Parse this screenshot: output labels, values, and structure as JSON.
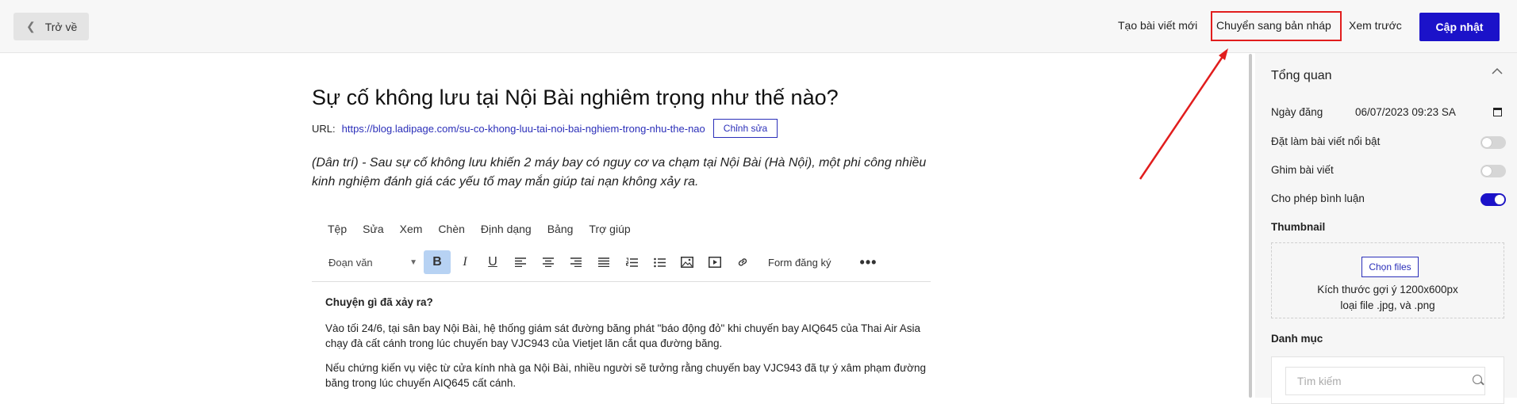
{
  "topbar": {
    "back_label": "Trở về",
    "new_post": "Tạo bài viết mới",
    "to_draft": "Chuyển sang bản nháp",
    "preview": "Xem trước",
    "update": "Cập nhật"
  },
  "annotation": {
    "highlight_color": "#e11d1d"
  },
  "post": {
    "title": "Sự cố không lưu tại Nội Bài nghiêm trọng như thế nào?",
    "url_label": "URL:",
    "url": "https://blog.ladipage.com/su-co-khong-luu-tai-noi-bai-nghiem-trong-nhu-the-nao",
    "edit_label": "Chỉnh sửa",
    "excerpt": "(Dân trí) - Sau sự cố không lưu khiến 2 máy bay có nguy cơ va chạm tại Nội Bài (Hà Nội), một phi công nhiều kinh nghiệm đánh giá các yếu tố may mắn giúp tai nạn không xảy ra."
  },
  "editor": {
    "menu": [
      "Tệp",
      "Sửa",
      "Xem",
      "Chèn",
      "Định dạng",
      "Bảng",
      "Trợ giúp"
    ],
    "paragraph_select": "Đoạn văn",
    "form_label": "Form đăng ký",
    "heading": "Chuyện gì đã xảy ra?",
    "paragraphs": [
      "Vào tối 24/6, tại sân bay Nội Bài, hệ thống giám sát đường băng phát \"báo động đỏ\" khi chuyến bay AIQ645 của Thai Air Asia chạy đà cất cánh trong lúc chuyến bay VJC943 của Vietjet lăn cắt qua đường băng.",
      "Nếu chứng kiến vụ việc từ cửa kính nhà ga Nội Bài, nhiều người sẽ tưởng rằng chuyến bay VJC943 đã tự ý xâm phạm đường băng trong lúc chuyến AIQ645 cất cánh."
    ]
  },
  "sidebar": {
    "overview": "Tổng quan",
    "date_label": "Ngày đăng",
    "date_value": "06/07/2023  09:23 SA",
    "featured_label": "Đặt làm bài viết nổi bật",
    "featured_on": false,
    "pin_label": "Ghim bài viết",
    "pin_on": false,
    "comments_label": "Cho phép bình luận",
    "comments_on": true,
    "thumbnail_title": "Thumbnail",
    "choose_files": "Chọn files",
    "size_hint": "Kích thước gợi ý 1200x600px",
    "type_hint": "loại file .jpg, và .png",
    "category_title": "Danh mục",
    "search_placeholder": "Tìm kiếm"
  },
  "colors": {
    "accent": "#1b12c9",
    "link": "#2b2fb9"
  }
}
